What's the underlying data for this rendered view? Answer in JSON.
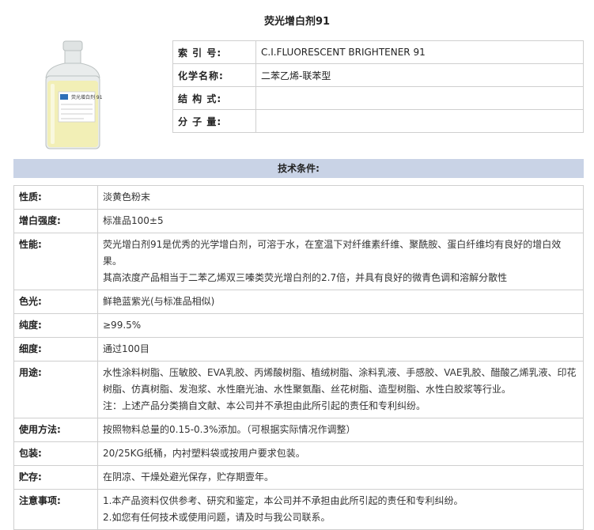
{
  "title": "荧光增白剂91",
  "product_image": {
    "icon": "chemical-bottle-icon",
    "bottle_label": "荧光增白剂 91",
    "powder_color": "#f2efb6",
    "glass_color": "#e9ecec",
    "label_accent": "#2e6fb8"
  },
  "basic_info": [
    {
      "label": "索 引 号:",
      "value": "C.I.FLUORESCENT BRIGHTENER 91"
    },
    {
      "label": "化学名称:",
      "value": "二苯乙烯-联苯型"
    },
    {
      "label": "结 构 式:",
      "value": ""
    },
    {
      "label": "分 子 量:",
      "value": ""
    }
  ],
  "section_header": "技术条件:",
  "header_color": "#c9d3e6",
  "specs": [
    {
      "label": "性质:",
      "lines": [
        "淡黄色粉末"
      ]
    },
    {
      "label": "增白强度:",
      "lines": [
        "标准品100±5"
      ]
    },
    {
      "label": "性能:",
      "lines": [
        "荧光增白剂91是优秀的光学增白剂，可溶于水，在室温下对纤维素纤维、聚酰胺、蛋白纤维均有良好的增白效果。",
        "其高浓度产品相当于二苯乙烯双三嗪类荧光增白剂的2.7倍，并具有良好的微青色调和溶解分散性"
      ]
    },
    {
      "label": "色光:",
      "lines": [
        "鲜艳蓝紫光(与标准品相似)"
      ]
    },
    {
      "label": "纯度:",
      "lines": [
        "≥99.5%"
      ]
    },
    {
      "label": "细度:",
      "lines": [
        "通过100目"
      ]
    },
    {
      "label": "用途:",
      "lines": [
        "水性涂料树脂、压敏胶、EVA乳胶、丙烯酸树脂、植绒树脂、涂料乳液、手感胶、VAE乳胶、醋酸乙烯乳液、印花树脂、仿真树脂、发泡浆、水性磨光油、水性聚氨酯、丝花树脂、造型树脂、水性白胶浆等行业。",
        "注：上述产品分类摘自文献、本公司并不承担由此所引起的责任和专利纠纷。"
      ]
    },
    {
      "label": "使用方法:",
      "lines": [
        "按照物料总量的0.15-0.3%添加。（可根据实际情况作调整）"
      ]
    },
    {
      "label": "包装:",
      "lines": [
        "20/25KG纸桶，内衬塑料袋或按用户要求包装。"
      ]
    },
    {
      "label": "贮存:",
      "lines": [
        "在阴凉、干燥处避光保存，贮存期壹年。"
      ]
    },
    {
      "label": "注意事项:",
      "lines": [
        "1.本产品资料仅供参考、研究和鉴定，本公司并不承担由此所引起的责任和专利纠纷。",
        "2.如您有任何技术或使用问题，请及时与我公司联系。"
      ]
    }
  ]
}
